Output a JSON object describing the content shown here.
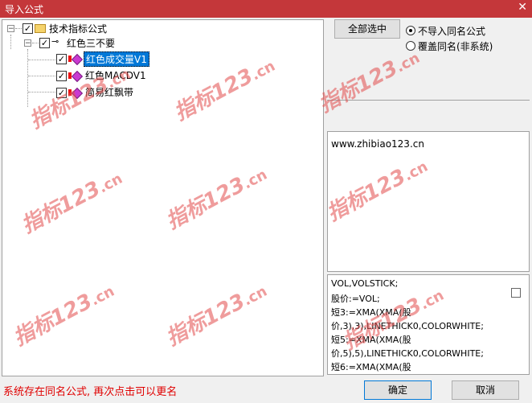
{
  "window": {
    "title": "导入公式",
    "close_glyph": "✕"
  },
  "tree": {
    "root": {
      "label": "技术指标公式",
      "checked": true
    },
    "group": {
      "label": "红色三不要",
      "checked": true
    },
    "items": [
      {
        "label": "红色成交量V1",
        "checked": true,
        "selected": true
      },
      {
        "label": "红色MACDV1",
        "checked": true,
        "selected": false
      },
      {
        "label": "简易红飘带",
        "checked": true,
        "selected": false
      }
    ]
  },
  "buttons": {
    "select_all": "全部选中",
    "ok": "确定",
    "cancel": "取消"
  },
  "options": [
    {
      "label": "不导入同名公式",
      "selected": true
    },
    {
      "label": "覆盖同名(非系统)",
      "selected": false
    }
  ],
  "info": {
    "url": "www.zhibiao123.cn"
  },
  "code": {
    "lines": [
      "VOL,VOLSTICK;",
      "股价:=VOL;",
      "短3:=XMA(XMA(股",
      "价,3),3),LINETHICK0,COLORWHITE;",
      "短5:=XMA(XMA(股",
      "价,5),5),LINETHICK0,COLORWHITE;",
      "短6:=XMA(XMA(股"
    ]
  },
  "status_message": "系统存在同名公式, 再次点击可以更名",
  "watermark": {
    "text": "指标123",
    "suffix": ".cn"
  },
  "colors": {
    "titlebar": "#c4373a",
    "selection": "#0078d7",
    "status": "#e00000"
  }
}
